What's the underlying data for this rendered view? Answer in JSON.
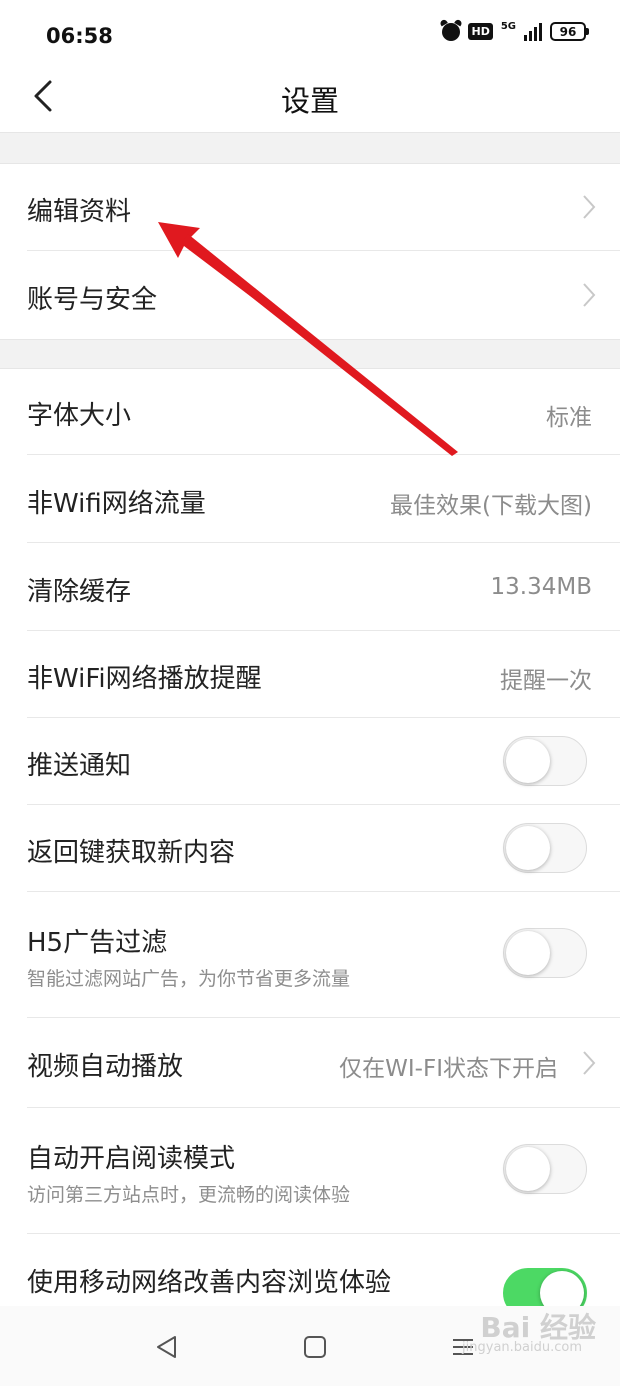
{
  "status_bar": {
    "time": "06:58",
    "hd": "HD",
    "network": "5G",
    "battery": "96"
  },
  "header": {
    "title": "设置"
  },
  "group1": [
    {
      "label": "编辑资料"
    },
    {
      "label": "账号与安全"
    }
  ],
  "group2": {
    "font_size": {
      "label": "字体大小",
      "value": "标准"
    },
    "non_wifi_traffic": {
      "label": "非Wifi网络流量",
      "value": "最佳效果(下载大图)"
    },
    "clear_cache": {
      "label": "清除缓存",
      "value": "13.34MB"
    },
    "non_wifi_play_remind": {
      "label": "非WiFi网络播放提醒",
      "value": "提醒一次"
    },
    "push_notification": {
      "label": "推送通知",
      "enabled": false
    },
    "back_key_refresh": {
      "label": "返回键获取新内容",
      "enabled": false
    },
    "h5_ad_filter": {
      "label": "H5广告过滤",
      "sub": "智能过滤网站广告，为你节省更多流量",
      "enabled": false
    },
    "video_autoplay": {
      "label": "视频自动播放",
      "value": "仅在WI-FI状态下开启"
    },
    "auto_reading_mode": {
      "label": "自动开启阅读模式",
      "sub": "访问第三方站点时，更流畅的阅读体验",
      "enabled": false
    },
    "mobile_network_improve": {
      "label": "使用移动网络改善内容浏览体验",
      "enabled": true
    }
  },
  "watermark": {
    "brand": "Bai 经验",
    "url": "jingyan.baidu.com"
  },
  "colors": {
    "toggle_on": "#4cd964",
    "arrow": "#e0191f",
    "divider_bg": "#f2f2f2"
  }
}
